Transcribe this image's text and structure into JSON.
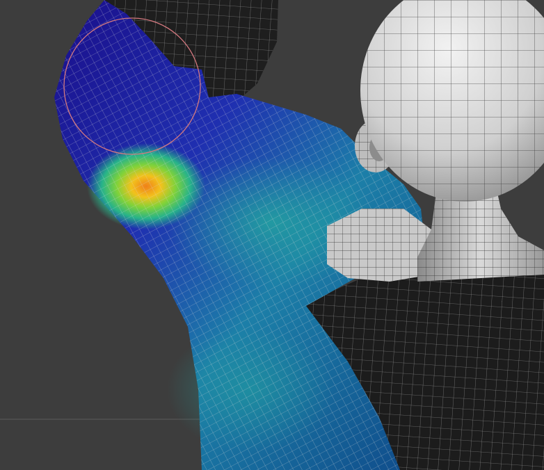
{
  "viewport": {
    "background": "#3d3d3d",
    "grid_line_color": "#5a5a5a"
  },
  "model": {
    "wire_color_light": "#d9d9d9",
    "wire_color_dark": "#bcbcbc",
    "body_shell_color": "#1c1c1c",
    "heatmap_palette": [
      "#1a0e8a",
      "#1f3fb0",
      "#1c8fa8",
      "#27b38a",
      "#7fd23a",
      "#f2c21c",
      "#f0801a"
    ]
  },
  "brush_cursor": {
    "color": "#d4797f",
    "icon": "circle-brush-cursor-icon"
  }
}
